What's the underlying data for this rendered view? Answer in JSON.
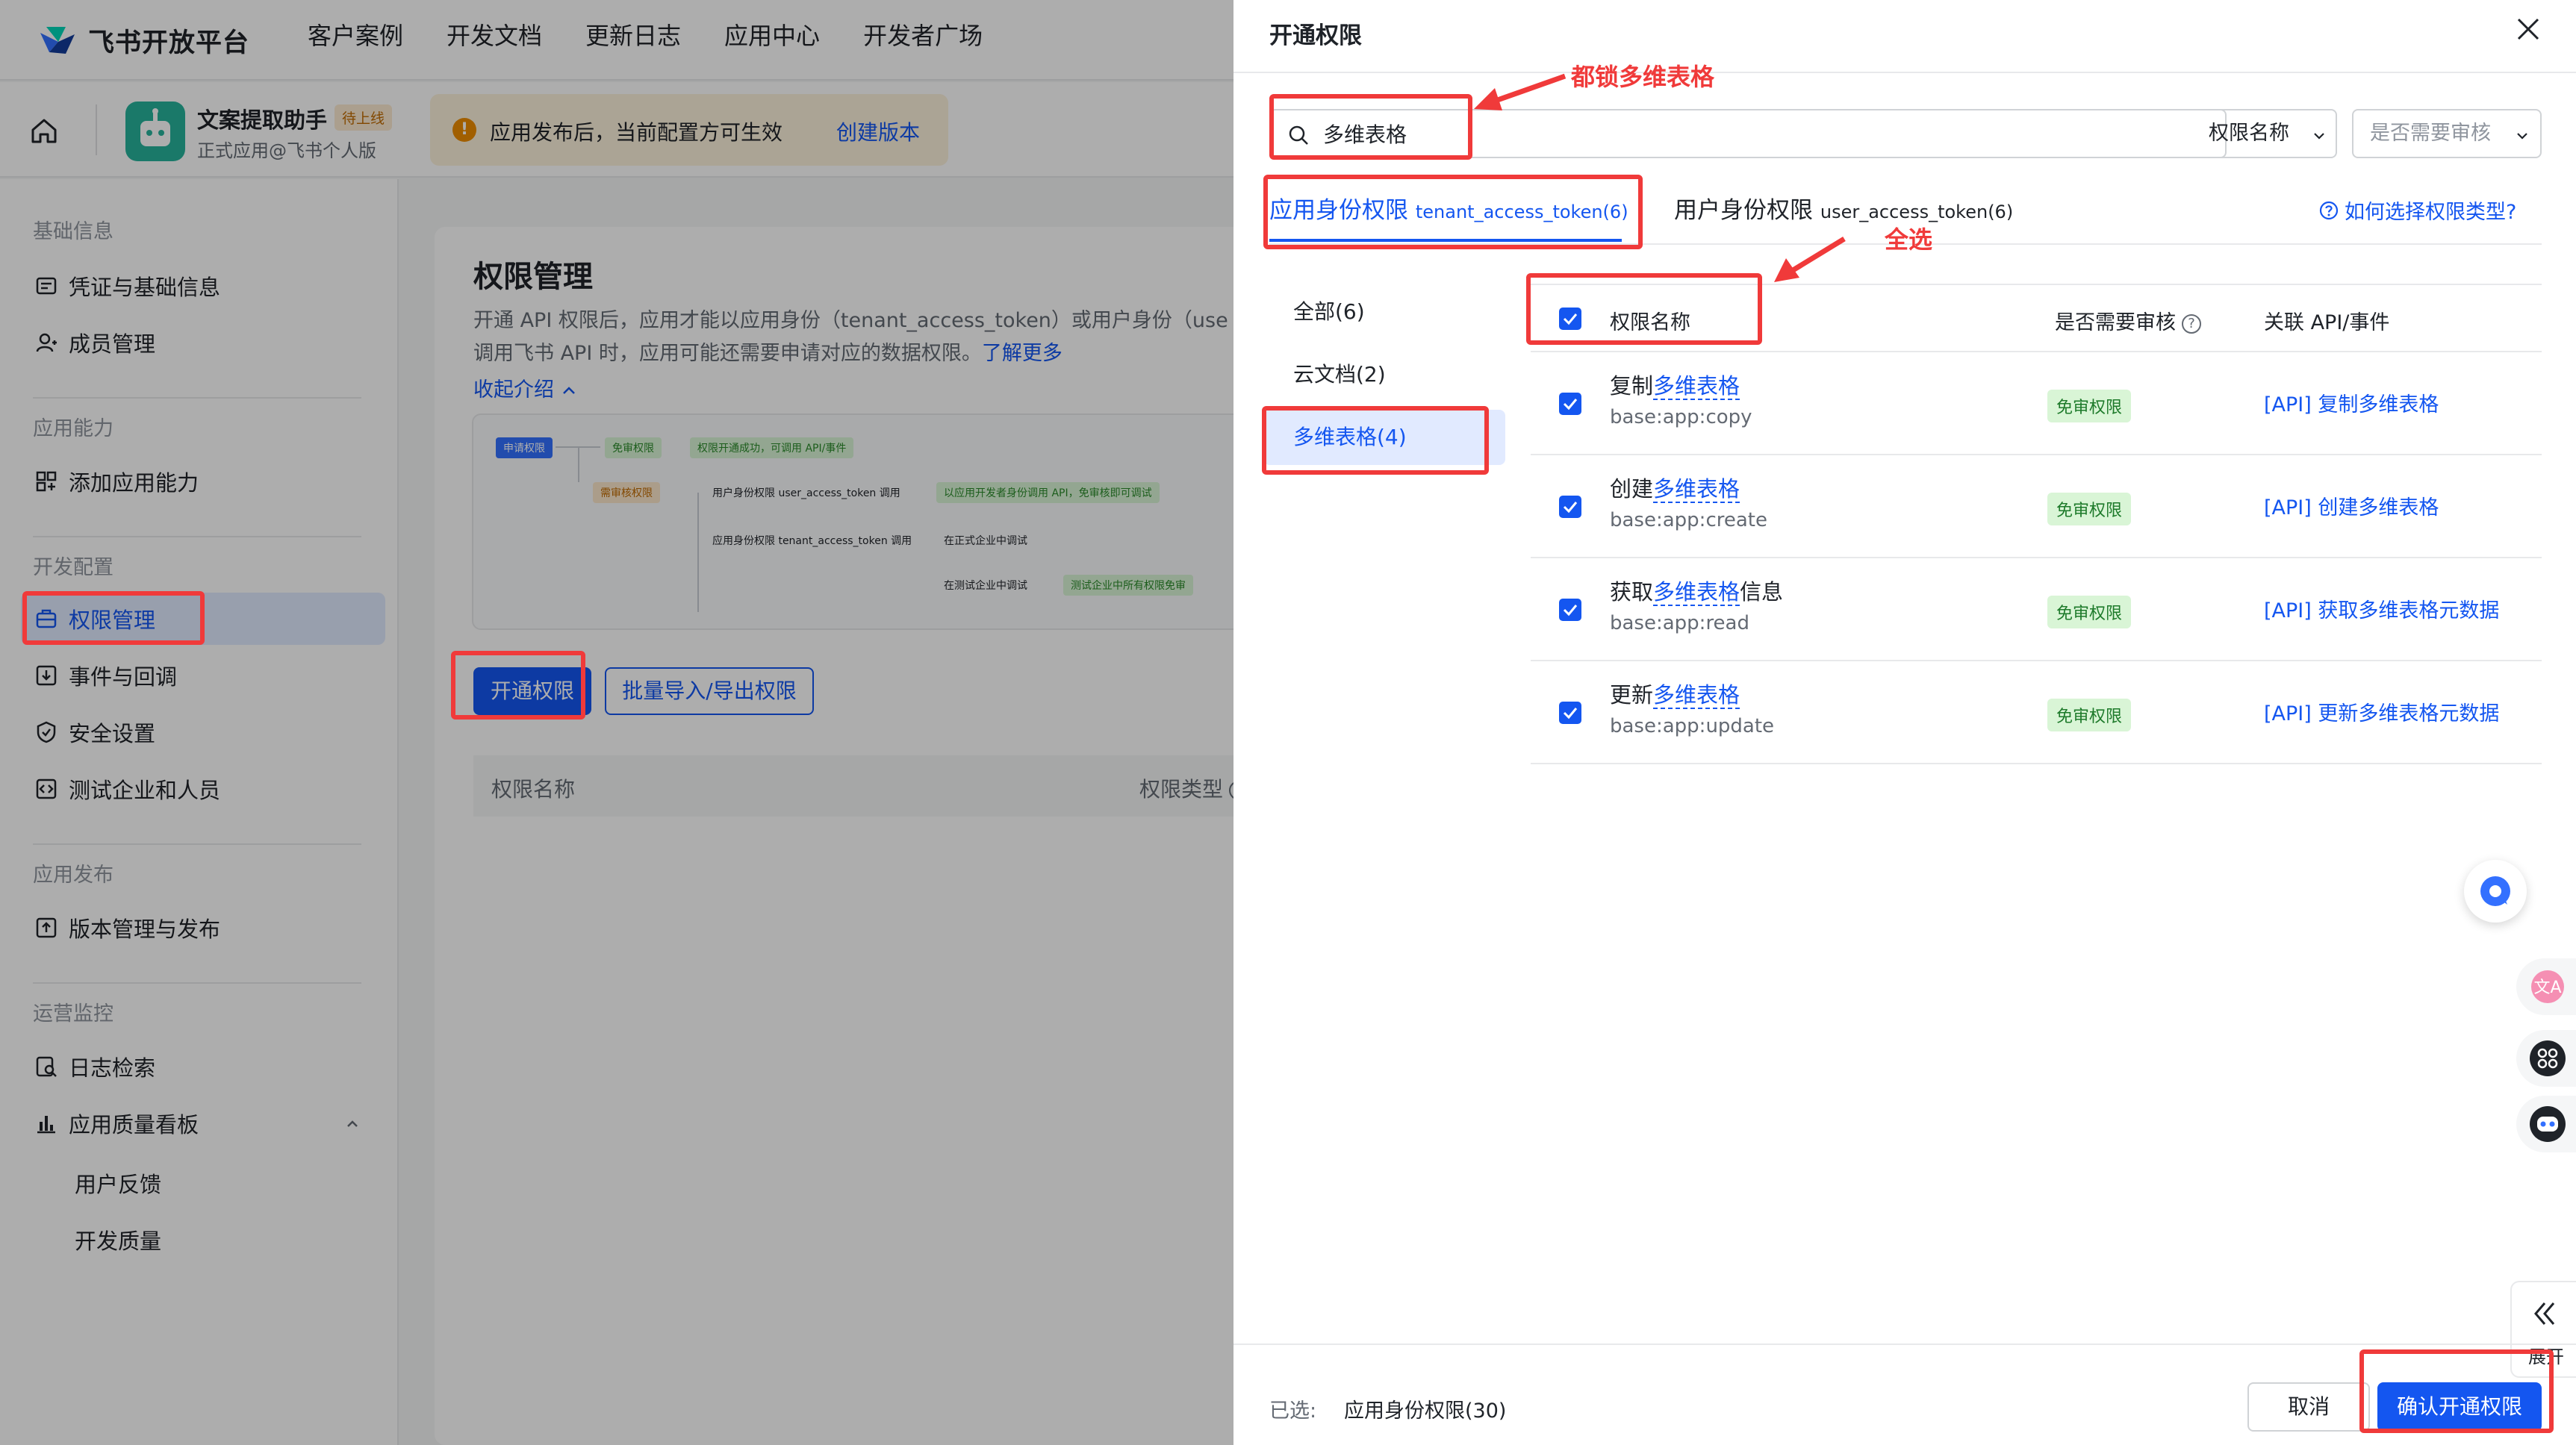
{
  "brand": {
    "name": "飞书开放平台"
  },
  "topnav": [
    "客户案例",
    "开发文档",
    "更新日志",
    "应用中心",
    "开发者广场"
  ],
  "app": {
    "name": "文案提取助手",
    "status": "待上线",
    "subtitle": "正式应用@飞书个人版",
    "notice": "应用发布后，当前配置方可生效",
    "notice_link": "创建版本"
  },
  "sidebar": {
    "sections": [
      {
        "title": "基础信息",
        "items": [
          "凭证与基础信息",
          "成员管理"
        ]
      },
      {
        "title": "应用能力",
        "items": [
          "添加应用能力"
        ]
      },
      {
        "title": "开发配置",
        "items": [
          "权限管理",
          "事件与回调",
          "安全设置",
          "测试企业和人员"
        ]
      },
      {
        "title": "应用发布",
        "items": [
          "版本管理与发布"
        ]
      },
      {
        "title": "运营监控",
        "items": [
          "日志检索",
          "应用质量看板"
        ],
        "subitems": [
          "用户反馈",
          "开发质量"
        ]
      }
    ]
  },
  "content": {
    "title": "权限管理",
    "desc_line1": "开通 API 权限后，应用才能以应用身份（tenant_access_token）或用户身份（use",
    "desc_line2": "调用飞书 API 时，应用可能还需要申请对应的数据权限。",
    "learn_more": "了解更多",
    "collapse": "收起介绍",
    "flow": {
      "apply": "申请权限",
      "free": "免审权限",
      "free_result": "权限开通成功，可调用 API/事件",
      "need": "需审核权限",
      "user_call": "用户身份权限 user_access_token 调用",
      "user_result": "以应用开发者身份调用 API，免审核即可调试",
      "tenant_call": "应用身份权限 tenant_access_token 调用",
      "formal": "在正式企业中调试",
      "test": "在测试企业中调试",
      "test_result": "测试企业中所有权限免审"
    },
    "btn_enable": "开通权限",
    "btn_batch": "批量导入/导出权限",
    "col_name": "权限名称",
    "col_type": "权限类型"
  },
  "drawer": {
    "title": "开通权限",
    "search_value": "多维表格",
    "filter_name": "权限名称",
    "filter_audit": "是否需要审核",
    "tab_app": "应用身份权限",
    "tab_app_token": "tenant_access_token(6)",
    "tab_user": "用户身份权限",
    "tab_user_token": "user_access_token(6)",
    "help": "如何选择权限类型?",
    "categories": [
      "全部(6)",
      "云文档(2)",
      "多维表格(4)"
    ],
    "th_name": "权限名称",
    "th_audit": "是否需要审核",
    "th_api": "关联 API/事件",
    "rows": [
      {
        "prefix": "复制",
        "hl": "多维表格",
        "suffix": "",
        "key": "base:app:copy",
        "tag": "免审权限",
        "api": "[API] 复制多维表格"
      },
      {
        "prefix": "创建",
        "hl": "多维表格",
        "suffix": "",
        "key": "base:app:create",
        "tag": "免审权限",
        "api": "[API] 创建多维表格"
      },
      {
        "prefix": "获取",
        "hl": "多维表格",
        "suffix": "信息",
        "key": "base:app:read",
        "tag": "免审权限",
        "api": "[API] 获取多维表格元数据"
      },
      {
        "prefix": "更新",
        "hl": "多维表格",
        "suffix": "",
        "key": "base:app:update",
        "tag": "免审权限",
        "api": "[API] 更新多维表格元数据"
      }
    ],
    "selected_label": "已选:",
    "selected_value": "应用身份权限(30)",
    "cancel": "取消",
    "confirm": "确认开通权限",
    "expand": "展开"
  },
  "annotations": {
    "search": "都锁多维表格",
    "select_all": "全选"
  },
  "colors": {
    "accent": "#1456f0",
    "annotation": "#f03a3a",
    "free_tag_bg": "#d9f5d6"
  }
}
